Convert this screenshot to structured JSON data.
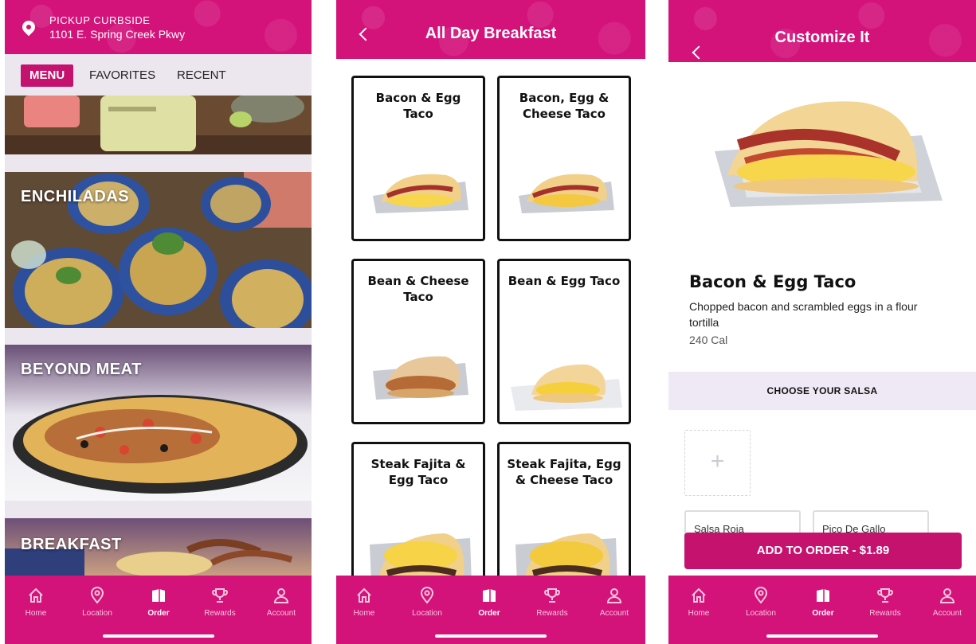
{
  "colors": {
    "brand_pink": "#d3127a",
    "tab_bg": "#ece7ef",
    "section_bg": "#efe9f6"
  },
  "menu_screen": {
    "pickup_label": "PICKUP CURBSIDE",
    "address": "1101 E. Spring Creek Pkwy",
    "tabs": [
      {
        "label": "MENU",
        "active": true
      },
      {
        "label": "FAVORITES",
        "active": false
      },
      {
        "label": "RECENT",
        "active": false
      }
    ],
    "categories": [
      {
        "label": "ENCHILADAS"
      },
      {
        "label": "BEYOND MEAT"
      },
      {
        "label": "BREAKFAST"
      }
    ]
  },
  "breakfast_screen": {
    "title": "All Day Breakfast",
    "items": [
      {
        "name": "Bacon & Egg Taco"
      },
      {
        "name": "Bacon, Egg & Cheese Taco"
      },
      {
        "name": "Bean & Cheese Taco"
      },
      {
        "name": "Bean & Egg Taco"
      },
      {
        "name": "Steak Fajita & Egg Taco"
      },
      {
        "name": "Steak Fajita, Egg & Cheese  Taco"
      }
    ]
  },
  "customize_screen": {
    "title": "Customize It",
    "product_name": "Bacon & Egg Taco",
    "description": "Chopped bacon and scrambled eggs in a flour tortilla",
    "calories": "240 Cal",
    "section_label": "CHOOSE YOUR SALSA",
    "add_icon": "plus-icon",
    "salsa_options": [
      "Salsa Roja",
      "Pico De Gallo"
    ],
    "add_button": "ADD TO ORDER - $1.89"
  },
  "nav": {
    "items": [
      {
        "label": "Home",
        "icon": "home-icon"
      },
      {
        "label": "Location",
        "icon": "location-pin-icon"
      },
      {
        "label": "Order",
        "icon": "bag-icon",
        "active": true
      },
      {
        "label": "Rewards",
        "icon": "trophy-icon"
      },
      {
        "label": "Account",
        "icon": "person-icon"
      }
    ]
  }
}
